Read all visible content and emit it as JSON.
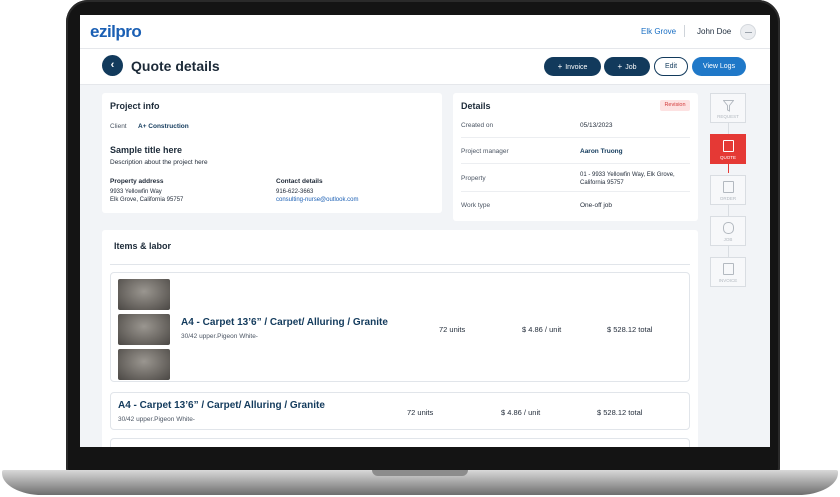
{
  "header": {
    "logo_main": "ezil",
    "logo_accent": "pro",
    "branch": "Elk Grove",
    "user_name": "John Doe"
  },
  "titlebar": {
    "title": "Quote details",
    "buttons": {
      "invoice": "Invoice",
      "job": "Job",
      "edit": "Edit",
      "view_logs": "View Logs"
    }
  },
  "project_info": {
    "title": "Project info",
    "client_label": "Client",
    "client_value": "A+ Construction",
    "project_title": "Sample title here",
    "project_desc": "Description about the project here",
    "property_address_label": "Property address",
    "property_address_line1": "9933 Yellowfin Way",
    "property_address_line2": "Elk Grove, California 95757",
    "contact_label": "Contact details",
    "contact_phone": "916-622-3663",
    "contact_email": "consulting-nurse@outlook.com"
  },
  "details": {
    "title": "Details",
    "badge": "Revision",
    "rows": [
      {
        "label": "Created on",
        "value": "05/13/2023"
      },
      {
        "label": "Project manager",
        "value": "Aaron Truong"
      },
      {
        "label": "Property",
        "value": "01 - 9933 Yellowfin Way, Elk Grove, California 95757"
      },
      {
        "label": "Work type",
        "value": "One-off job"
      }
    ]
  },
  "stepper": [
    {
      "label": "REQUEST",
      "active": false
    },
    {
      "label": "QUOTE",
      "active": true
    },
    {
      "label": "ORDER",
      "active": false
    },
    {
      "label": "JOB",
      "active": false
    },
    {
      "label": "INVOICE",
      "active": false
    }
  ],
  "items": {
    "title": "Items & labor",
    "rows": [
      {
        "name": "A4 - Carpet 13’6” / Carpet/ Alluring / Granite",
        "sub": "30/42 upper.Pigeon White-",
        "units": "72 units",
        "price": "$ 4.86 / unit",
        "total": "$ 528.12 total"
      },
      {
        "name": "A4 - Carpet 13’6” / Carpet/ Alluring / Granite",
        "sub": "30/42 upper.Pigeon White-",
        "units": "72 units",
        "price": "$ 4.86 / unit",
        "total": "$ 528.12 total"
      }
    ]
  }
}
